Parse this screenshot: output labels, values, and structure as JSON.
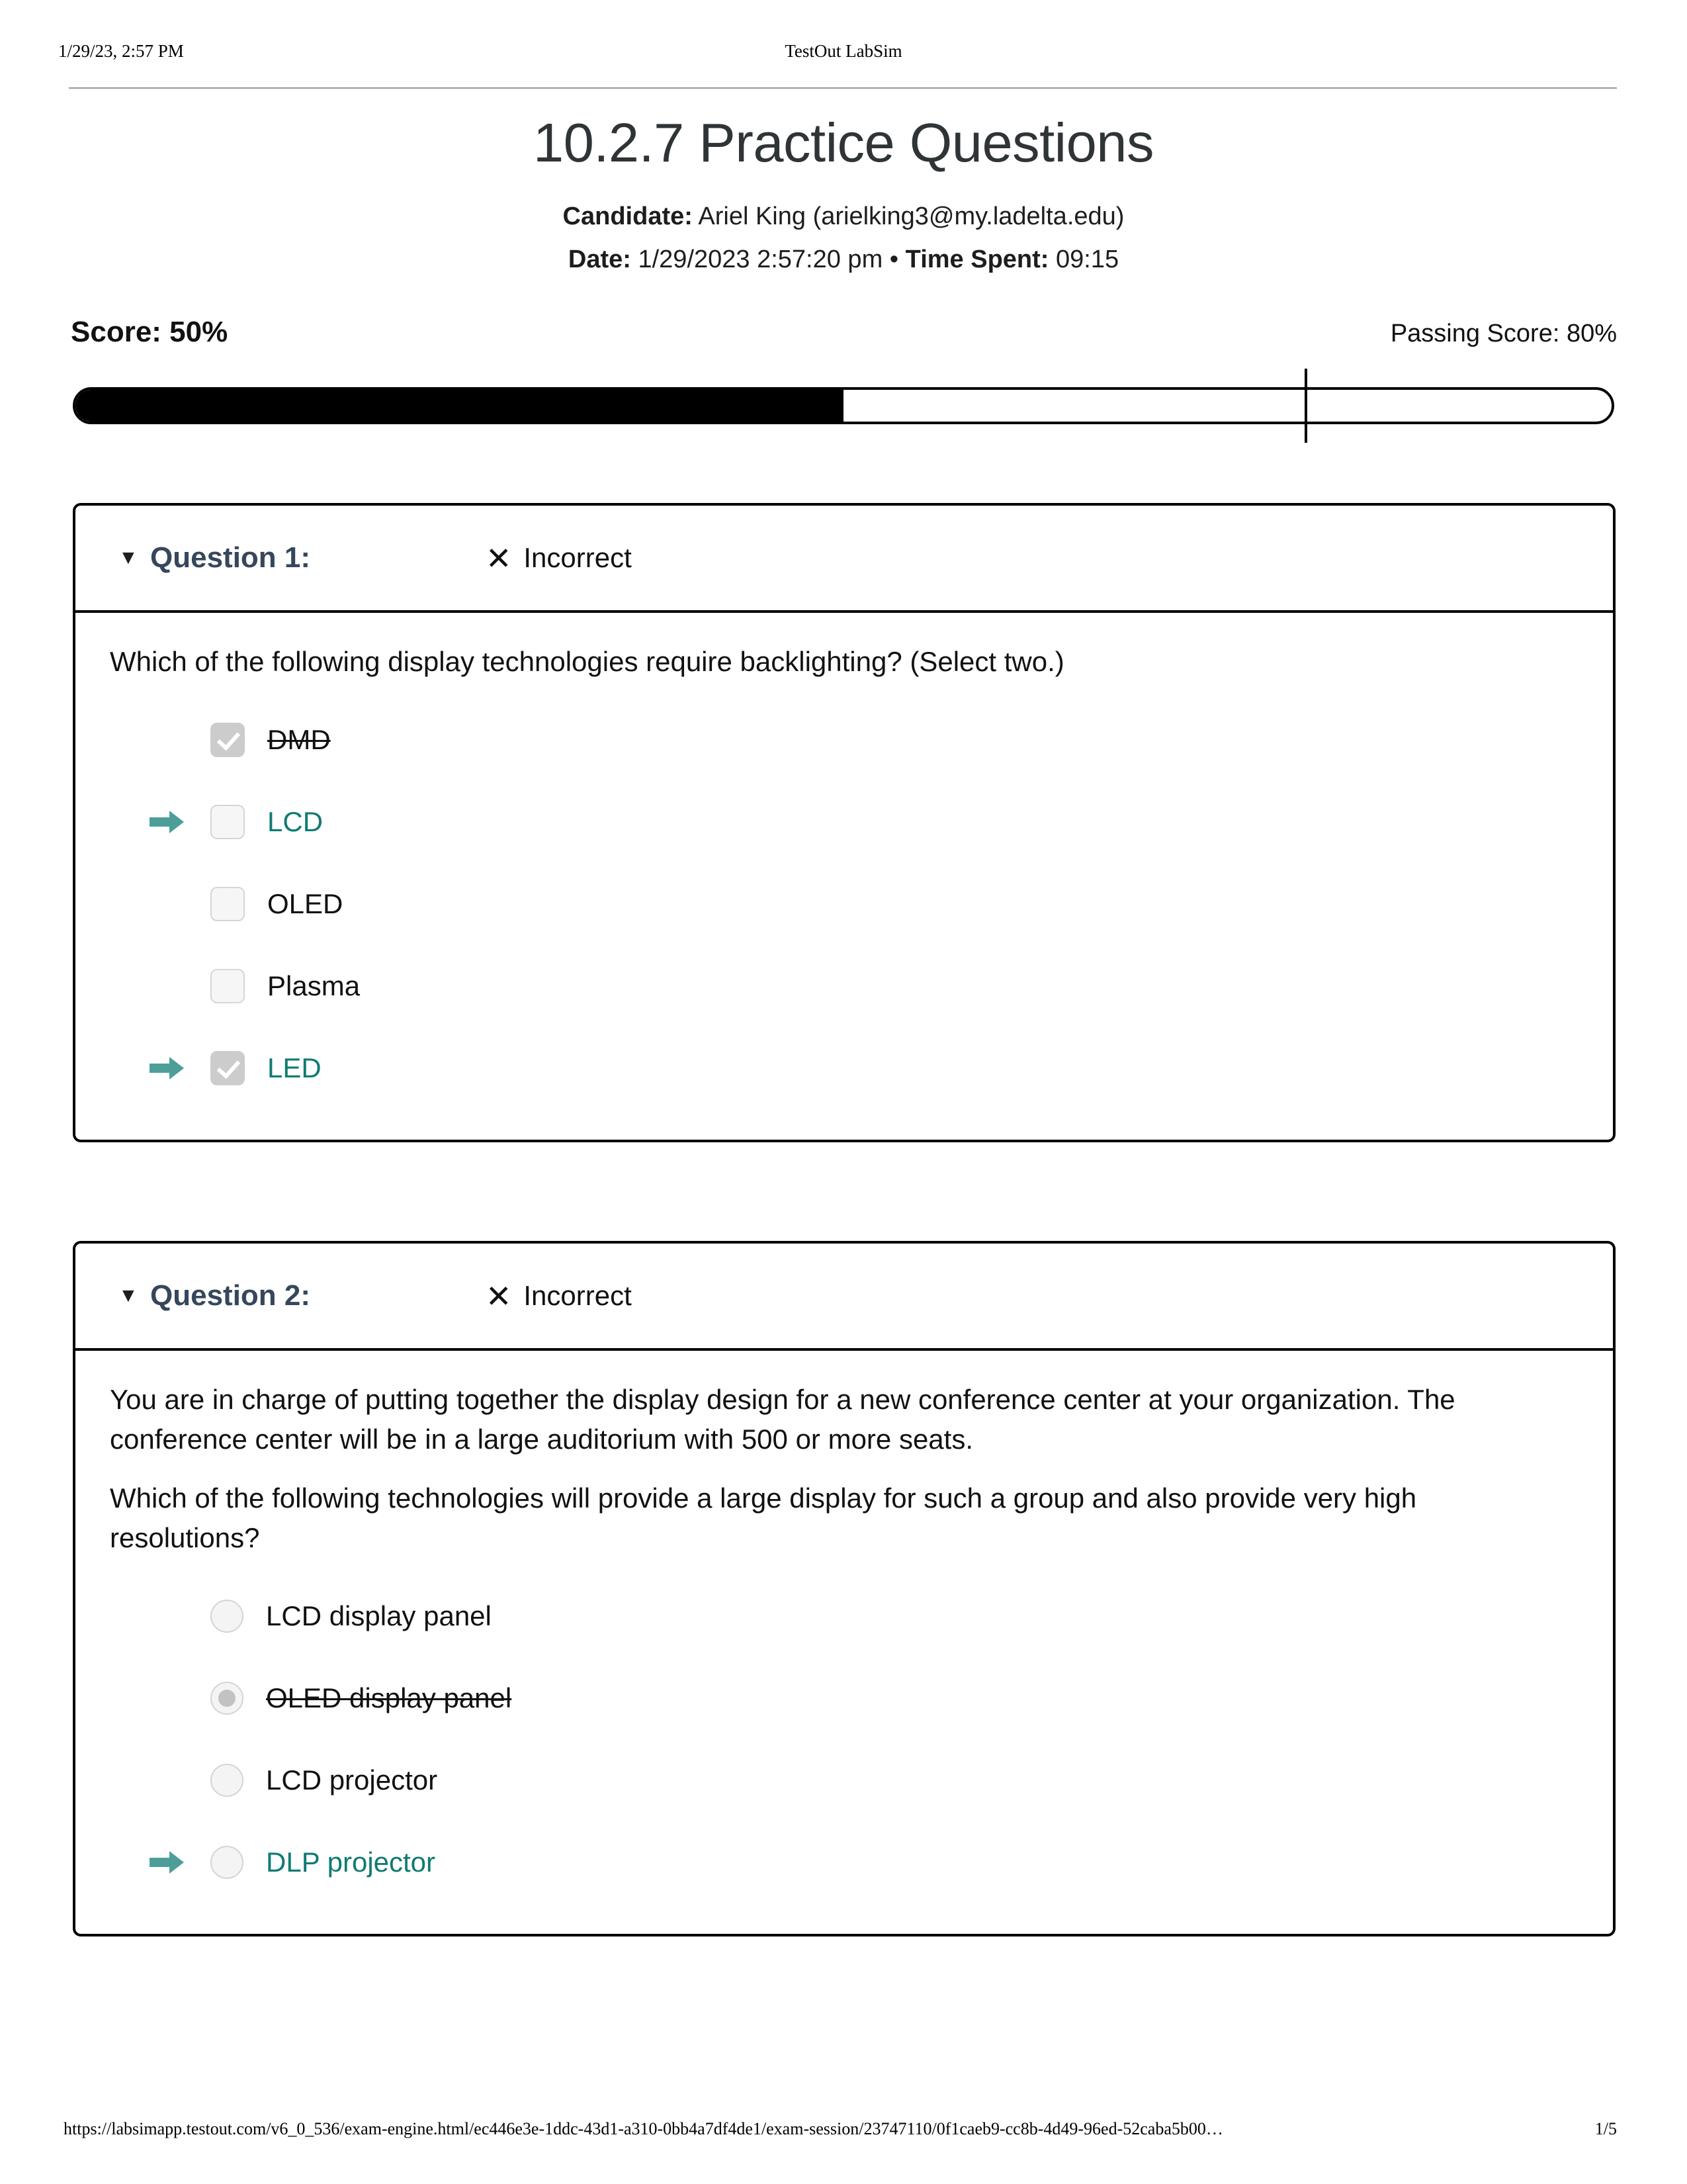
{
  "print_header": {
    "left": "1/29/23, 2:57 PM",
    "center": "TestOut LabSim"
  },
  "title": "10.2.7 Practice Questions",
  "meta": {
    "candidate_label": "Candidate:",
    "candidate_value": "Ariel King  (arielking3@my.ladelta.edu)",
    "date_label": "Date:",
    "date_value": "1/29/2023 2:57:20 pm",
    "separator": "•",
    "time_label": "Time Spent:",
    "time_value": "09:15"
  },
  "score": {
    "score_text": "Score: 50%",
    "passing_text": "Passing Score: 80%",
    "score_percent": 50,
    "passing_percent": 80
  },
  "colors": {
    "accent_teal": "#0f7b72",
    "arrow_teal": "#4d9e99",
    "question_title": "#36475c",
    "bar_fill": "#000000",
    "checkbox_checked": "#cccccc"
  },
  "questions": [
    {
      "caret": "▼",
      "label": "Question 1:",
      "status_icon": "✕",
      "status_text": "Incorrect",
      "paragraphs": [
        "Which of the following display technologies require backlighting? (Select two.)"
      ],
      "input_type": "checkbox",
      "options": [
        {
          "label": "DMD",
          "checked": true,
          "correct": false,
          "struck": true,
          "arrow": false
        },
        {
          "label": "LCD",
          "checked": false,
          "correct": true,
          "struck": false,
          "arrow": true
        },
        {
          "label": "OLED",
          "checked": false,
          "correct": false,
          "struck": false,
          "arrow": false
        },
        {
          "label": "Plasma",
          "checked": false,
          "correct": false,
          "struck": false,
          "arrow": false
        },
        {
          "label": "LED",
          "checked": true,
          "correct": true,
          "struck": false,
          "arrow": true
        }
      ]
    },
    {
      "caret": "▼",
      "label": "Question 2:",
      "status_icon": "✕",
      "status_text": "Incorrect",
      "paragraphs": [
        "You are in charge of putting together the display design for a new conference center at your organization. The conference center will be in a large auditorium with 500 or more seats.",
        "Which of the following technologies will provide a large display for such a group and also provide very high resolutions?"
      ],
      "input_type": "radio",
      "options": [
        {
          "label": "LCD display panel",
          "checked": false,
          "correct": false,
          "struck": false,
          "arrow": false
        },
        {
          "label": "OLED display panel",
          "checked": true,
          "correct": false,
          "struck": true,
          "arrow": false
        },
        {
          "label": "LCD projector",
          "checked": false,
          "correct": false,
          "struck": false,
          "arrow": false
        },
        {
          "label": "DLP projector",
          "checked": false,
          "correct": true,
          "struck": false,
          "arrow": true
        }
      ]
    }
  ],
  "print_footer": {
    "url": "https://labsimapp.testout.com/v6_0_536/exam-engine.html/ec446e3e-1ddc-43d1-a310-0bb4a7df4de1/exam-session/23747110/0f1caeb9-cc8b-4d49-96ed-52caba5b00…",
    "page": "1/5"
  }
}
